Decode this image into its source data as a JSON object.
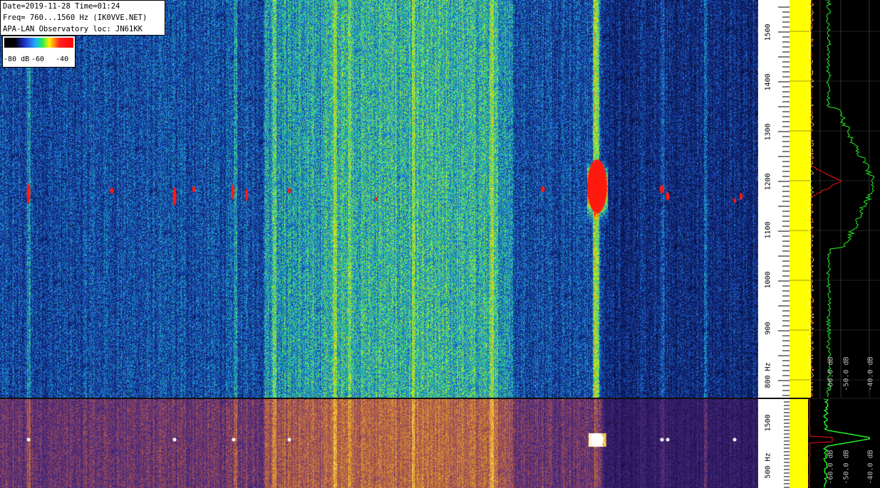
{
  "info": {
    "line1": "Date=2019-11-28 Time=01:24",
    "line2": "Freq= 760...1560 Hz (IK0VVE.NET)",
    "line3": "APA-LAN Observatory loc: JN61KK"
  },
  "legend": {
    "label_a": "-80 dB",
    "label_b": "-60",
    "label_c": "-40"
  },
  "scale_main": {
    "ticks": [
      "1500",
      "1400",
      "1300",
      "1200",
      "1100",
      "1000",
      "900",
      "800 Hz"
    ]
  },
  "scale_bottom": {
    "ticks": [
      "1500",
      "500 Hz"
    ]
  },
  "spectrum_main": {
    "db_labels": [
      "-60.0 dB",
      "-50.0 dB",
      "-40.0 dB"
    ]
  },
  "spectrum_bottom": {
    "db_labels": [
      "-60.0 dB",
      "-50.0 dB",
      "-40.0 dB"
    ]
  },
  "colors": {
    "yellow_trace": "#ffff00",
    "green_trace": "#22ee22",
    "red_trace": "#ee1111"
  }
}
